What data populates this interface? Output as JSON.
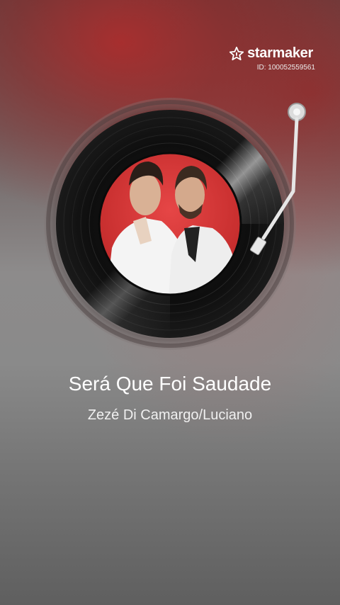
{
  "brand": {
    "name": "starmaker",
    "id_text": "ID: 100052559561",
    "logo_icon": "star-logo-icon"
  },
  "song": {
    "title": "Será Que Foi Saudade",
    "artist": "Zezé Di Camargo/Luciano"
  },
  "turntable": {
    "cover_description_icon": "album-cover-image",
    "cover_background": "#d83a3a",
    "vinyl_color": "#111111",
    "tonearm_color": "#e8e8e8"
  }
}
